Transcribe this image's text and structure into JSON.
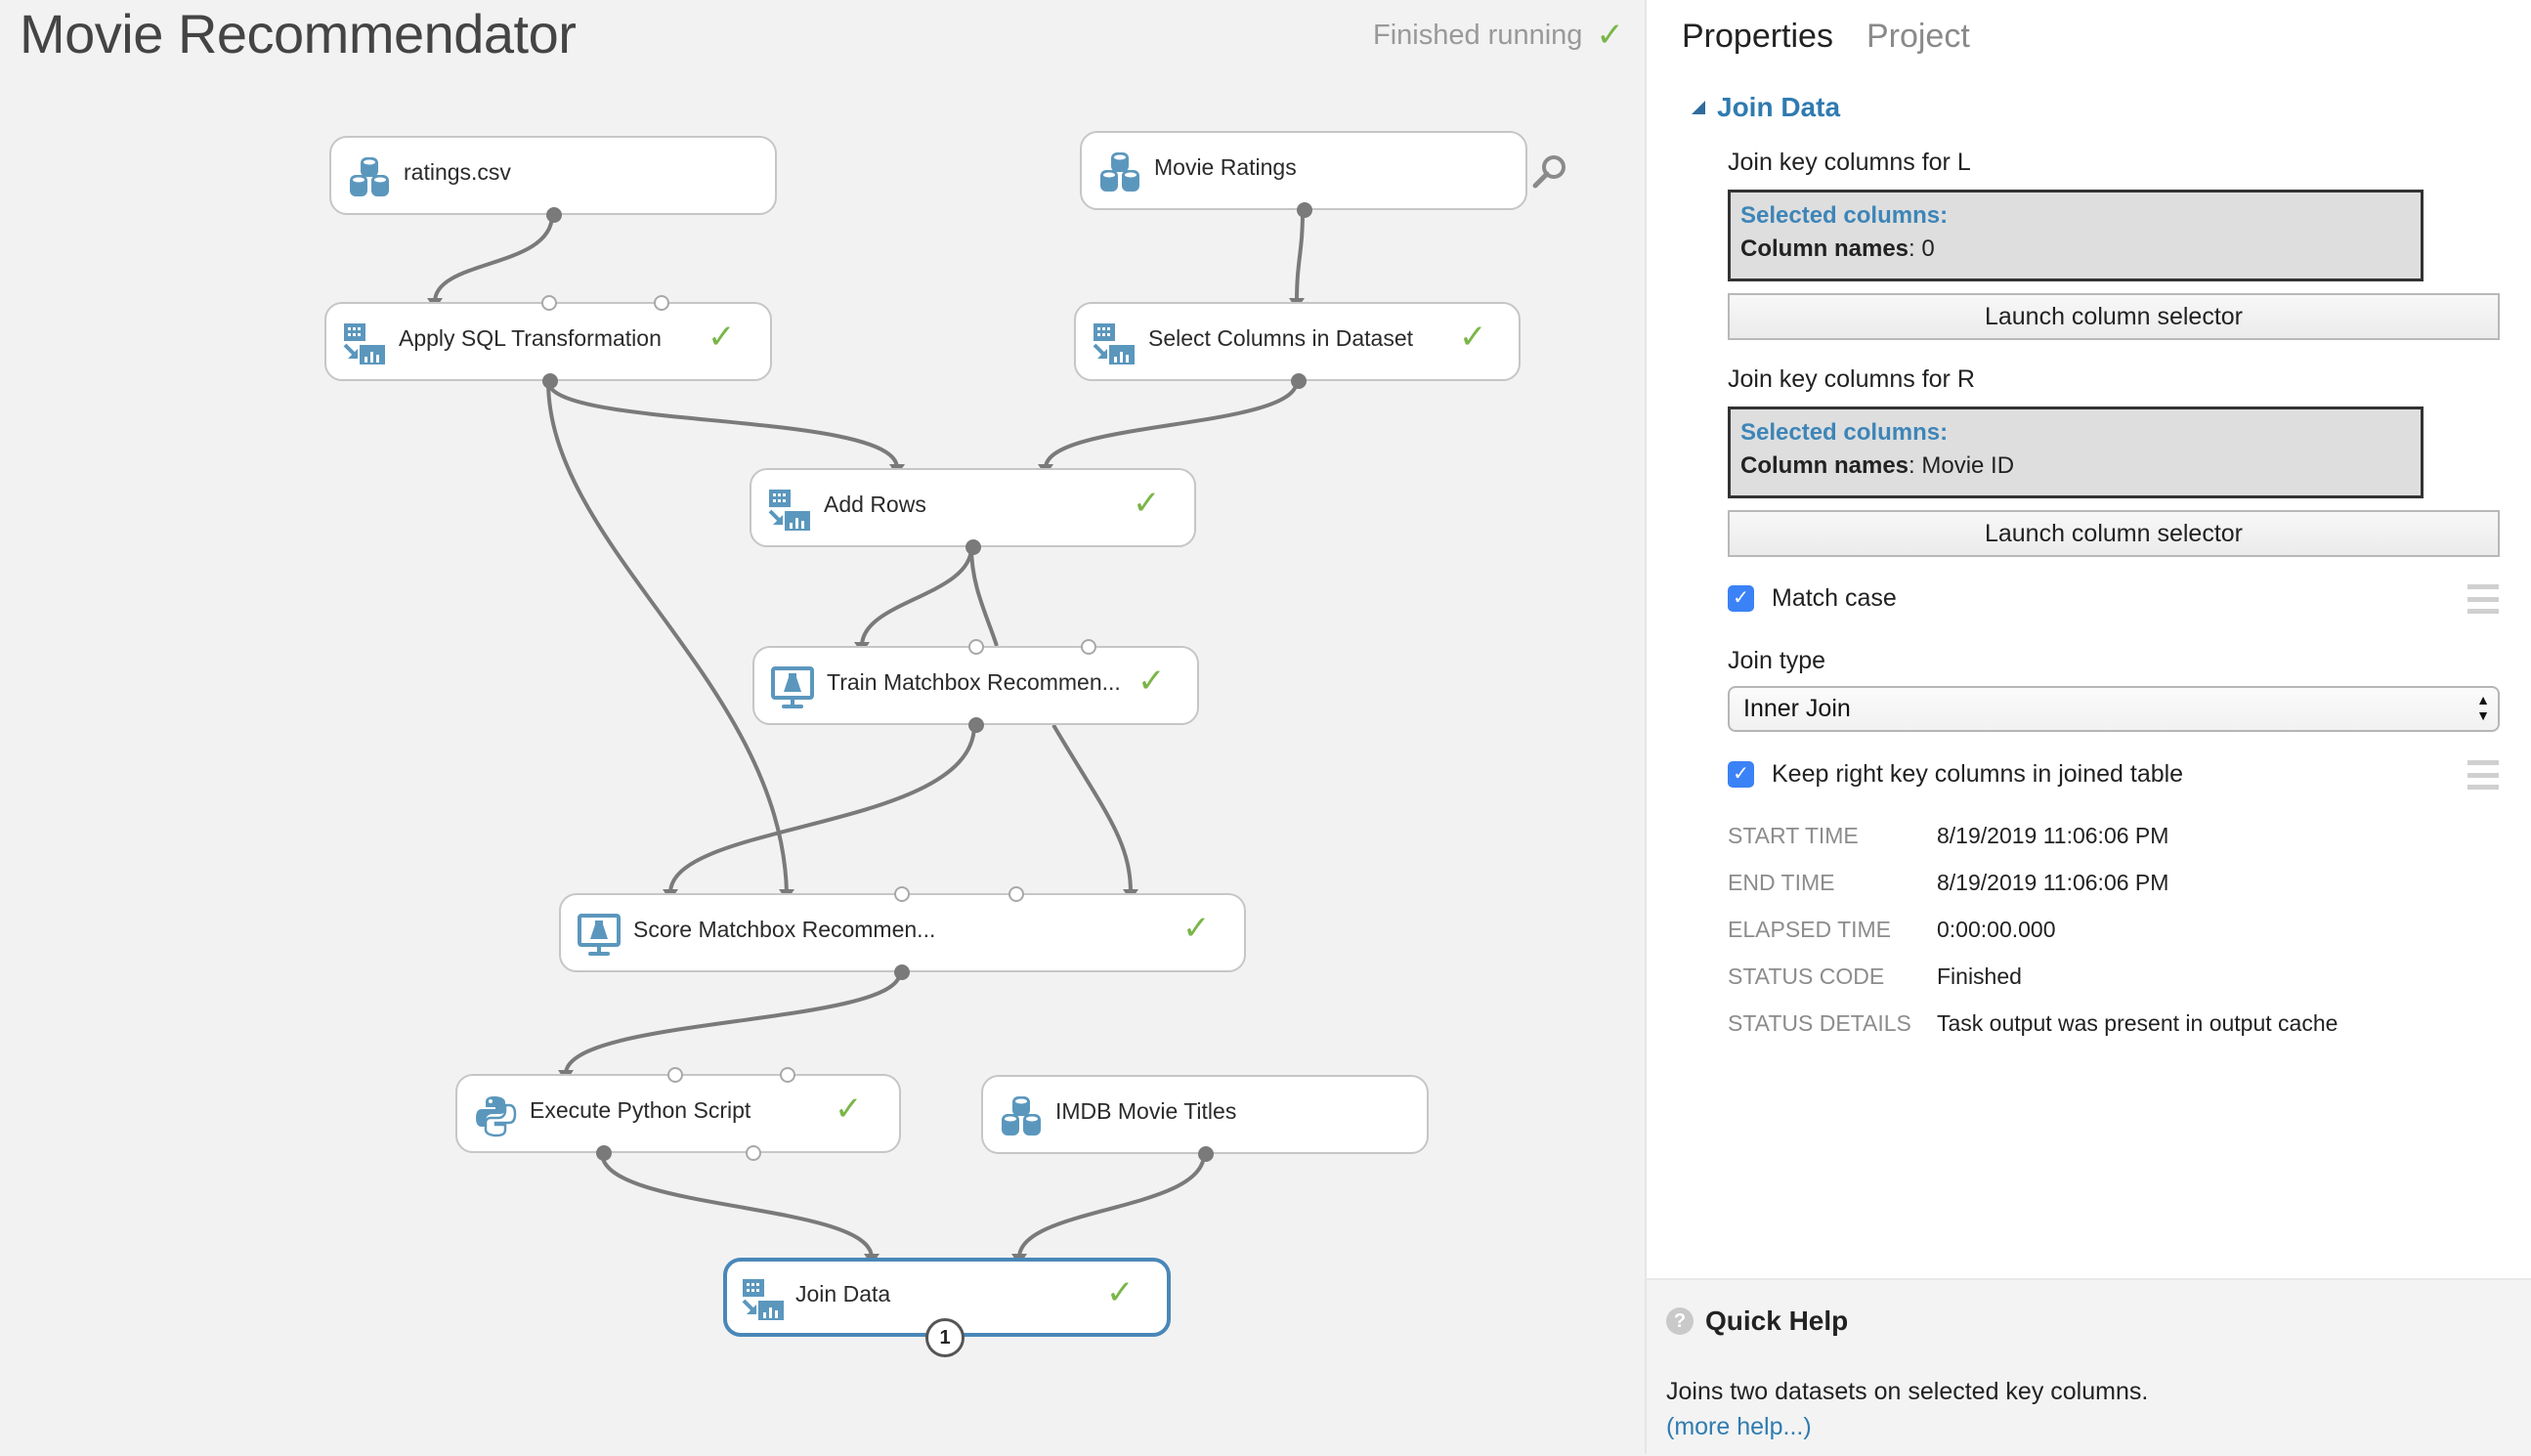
{
  "header": {
    "title": "Movie Recommendator",
    "status_text": "Finished running",
    "status_icon": "check-icon"
  },
  "canvas": {
    "nodes": [
      {
        "id": "ratings-csv",
        "label": "ratings.csv",
        "icon": "dataset-icon",
        "completed": false
      },
      {
        "id": "movie-ratings",
        "label": "Movie Ratings",
        "icon": "dataset-icon",
        "completed": false
      },
      {
        "id": "apply-sql",
        "label": "Apply SQL Transformation",
        "icon": "transform-icon",
        "completed": true
      },
      {
        "id": "select-columns",
        "label": "Select Columns in Dataset",
        "icon": "transform-icon",
        "completed": true
      },
      {
        "id": "add-rows",
        "label": "Add Rows",
        "icon": "transform-icon",
        "completed": true
      },
      {
        "id": "train-matchbox",
        "label": "Train Matchbox Recommen...",
        "icon": "ml-train-icon",
        "completed": true
      },
      {
        "id": "score-matchbox",
        "label": "Score Matchbox Recommen...",
        "icon": "ml-train-icon",
        "completed": true
      },
      {
        "id": "execute-python",
        "label": "Execute Python Script",
        "icon": "python-icon",
        "completed": true
      },
      {
        "id": "imdb-titles",
        "label": "IMDB Movie Titles",
        "icon": "dataset-icon",
        "completed": false
      },
      {
        "id": "join-data",
        "label": "Join Data",
        "icon": "transform-icon",
        "completed": true,
        "selected": true,
        "badge": "1"
      }
    ],
    "edges": [
      [
        "ratings-csv",
        "apply-sql"
      ],
      [
        "movie-ratings",
        "select-columns"
      ],
      [
        "apply-sql",
        "add-rows"
      ],
      [
        "select-columns",
        "add-rows"
      ],
      [
        "apply-sql",
        "score-matchbox"
      ],
      [
        "add-rows",
        "train-matchbox"
      ],
      [
        "add-rows",
        "score-matchbox"
      ],
      [
        "train-matchbox",
        "score-matchbox"
      ],
      [
        "score-matchbox",
        "execute-python"
      ],
      [
        "execute-python",
        "join-data"
      ],
      [
        "imdb-titles",
        "join-data"
      ]
    ]
  },
  "panel": {
    "tabs": [
      {
        "label": "Properties",
        "active": true
      },
      {
        "label": "Project",
        "active": false
      }
    ],
    "section_title": "Join Data",
    "left_keys": {
      "label": "Join key columns for L",
      "selected_heading": "Selected columns:",
      "names_label": "Column names",
      "names_value": ": 0",
      "button": "Launch column selector"
    },
    "right_keys": {
      "label": "Join key columns for R",
      "selected_heading": "Selected columns:",
      "names_label": "Column names",
      "names_value": ": Movie ID",
      "button": "Launch column selector"
    },
    "match_case": {
      "label": "Match case",
      "checked": true
    },
    "join_type": {
      "label": "Join type",
      "value": "Inner Join"
    },
    "keep_right": {
      "label": "Keep right key columns in joined table",
      "checked": true
    },
    "run_info": [
      {
        "key": "START TIME",
        "value": "8/19/2019 11:06:06 PM"
      },
      {
        "key": "END TIME",
        "value": "8/19/2019 11:06:06 PM"
      },
      {
        "key": "ELAPSED TIME",
        "value": "0:00:00.000"
      },
      {
        "key": "STATUS CODE",
        "value": "Finished"
      },
      {
        "key": "STATUS DETAILS",
        "value": "Task output was present in output cache"
      }
    ]
  },
  "quick_help": {
    "title": "Quick Help",
    "text": "Joins two datasets on selected key columns.",
    "link": "(more help...)"
  },
  "colors": {
    "accent": "#2f7bb0",
    "success": "#7ab648",
    "selected_border": "#4a87b8",
    "icon_blue": "#5b97bd"
  }
}
